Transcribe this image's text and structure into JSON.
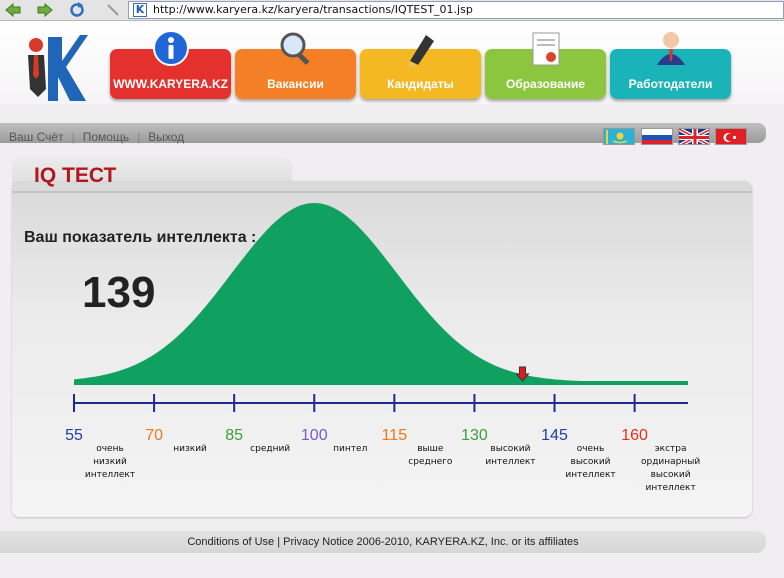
{
  "browser": {
    "url": "http://www.karyera.kz/karyera/transactions/IQTEST_01.jsp",
    "favicon": "K"
  },
  "nav": {
    "tabs": [
      {
        "label": "WWW.KARYERA.KZ",
        "icon": "info-icon",
        "color": "#e4312d"
      },
      {
        "label": "Вакансии",
        "icon": "magnifier-icon",
        "color": "#f47f26"
      },
      {
        "label": "Кандидаты",
        "icon": "pen-icon",
        "color": "#f4b823"
      },
      {
        "label": "Образование",
        "icon": "certificate-icon",
        "color": "#8cc63f"
      },
      {
        "label": "Работодатели",
        "icon": "person-icon",
        "color": "#1ab3b8"
      }
    ]
  },
  "user_links": [
    "Ваш Счёт",
    "Помощь",
    "Выход"
  ],
  "languages": [
    "kazakh-flag-icon",
    "russian-flag-icon",
    "uk-flag-icon",
    "turkish-flag-icon"
  ],
  "panel": {
    "title": "IQ ТЕСТ",
    "score_label": "Ваш показатель интеллекта :",
    "score": "139"
  },
  "chart_data": {
    "type": "area",
    "distribution": "normal",
    "mean": 100,
    "fill": "#10a060",
    "axis_min": 55,
    "axis_max": 170,
    "ticks": [
      55,
      70,
      85,
      100,
      115,
      130,
      145,
      160
    ],
    "tick_colors": [
      "#1f3fa8",
      "#f07a1a",
      "#3aa03a",
      "#7a5ac8",
      "#f07a1a",
      "#3aa03a",
      "#1f3fa8",
      "#e0311e"
    ],
    "categories": [
      {
        "lines": [
          "очень",
          "низкий",
          "интеллект"
        ]
      },
      {
        "lines": [
          "низкий"
        ]
      },
      {
        "lines": [
          "средний"
        ]
      },
      {
        "lines": [
          "пинтел"
        ]
      },
      {
        "lines": [
          "выше",
          "среднего"
        ]
      },
      {
        "lines": [
          "высокий",
          "интеллект"
        ]
      },
      {
        "lines": [
          "очень",
          "высокий",
          "интеллект"
        ]
      },
      {
        "lines": [
          "экстра",
          "ординарный",
          "высокий",
          "интеллект"
        ]
      }
    ],
    "marker_value": 139,
    "marker_color": "#d81e1e"
  },
  "footer": {
    "text": "Conditions of Use | Privacy Notice 2006-2010, KARYERA.KZ, Inc. or its affiliates"
  }
}
